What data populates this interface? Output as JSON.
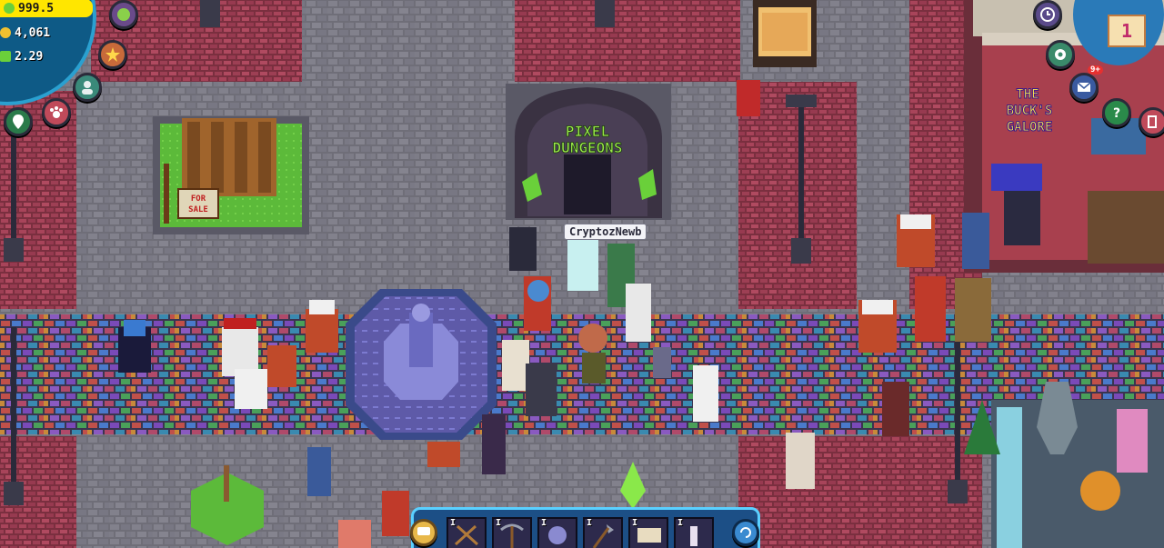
{
  "hud": {
    "energy": "999.5",
    "coins": "4,061",
    "pixel": "2.29",
    "notification_count": "9+",
    "calendar_day": "1"
  },
  "player": {
    "name": "CryptozNewb"
  },
  "buildings": {
    "dungeon_sign_line1": "PIXEL",
    "dungeon_sign_line2": "DUNGEONS",
    "shop_sign_line1": "THE",
    "shop_sign_line2": "BUCK'S",
    "shop_sign_line3": "GALORE",
    "sale_sign_line1": "FOR",
    "sale_sign_line2": "SALE"
  },
  "toolbar": {
    "slot_key": "I",
    "slots": [
      {
        "icon": "shears-icon"
      },
      {
        "icon": "pickaxe-icon"
      },
      {
        "icon": "creature-card-icon"
      },
      {
        "icon": "axe-icon"
      },
      {
        "icon": "scroll-icon"
      },
      {
        "icon": "potion-icon"
      }
    ]
  },
  "colors": {
    "hud_blue": "#0e5a86",
    "energy_yellow": "#ffe600",
    "toolbar_blue": "#1c4f86",
    "plaza_stone": "#7c7c86",
    "brick_red": "#9a3b4e"
  }
}
